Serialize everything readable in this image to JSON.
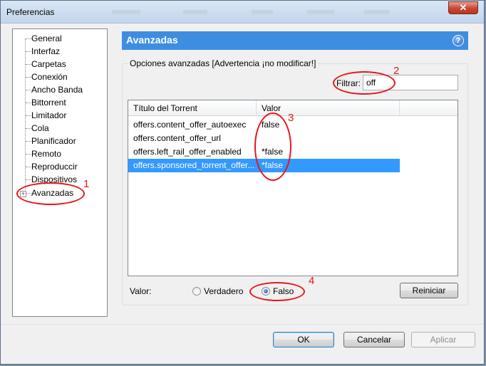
{
  "window": {
    "title": "Preferencias",
    "close_glyph": "✕"
  },
  "tree": {
    "items": [
      "General",
      "Interfaz",
      "Carpetas",
      "Conexión",
      "Ancho Banda",
      "Bittorrent",
      "Limitador",
      "Cola",
      "Planificador",
      "Remoto",
      "Reproduccir",
      "Dispositivos",
      "Avanzadas"
    ],
    "expander_glyph": "+"
  },
  "panel": {
    "title": "Avanzadas",
    "help_glyph": "?"
  },
  "group": {
    "label": "Opciones avanzadas [Advertencia ¡no modificar!]"
  },
  "filter": {
    "label": "Filtrar:",
    "value": "off"
  },
  "list": {
    "columns": [
      "Título del Torrent",
      "Valor"
    ],
    "rows": [
      {
        "name": "offers.content_offer_autoexec",
        "value": "false"
      },
      {
        "name": "offers.content_offer_url",
        "value": ""
      },
      {
        "name": "offers.left_rail_offer_enabled",
        "value": "*false"
      },
      {
        "name": "offers.sponsored_torrent_offer...",
        "value": "*false",
        "selected": true
      }
    ]
  },
  "value_row": {
    "label": "Valor:",
    "true_label": "Verdadero",
    "false_label": "Falso",
    "selected": "false"
  },
  "buttons": {
    "reset": "Reiniciar",
    "ok": "OK",
    "cancel": "Cancelar",
    "apply": "Aplicar"
  },
  "annotations": [
    "1",
    "2",
    "3",
    "4"
  ],
  "colors": {
    "header_blue": "#3d8ee0",
    "selection": "#3399ff",
    "annotation_red": "#e8151b"
  }
}
